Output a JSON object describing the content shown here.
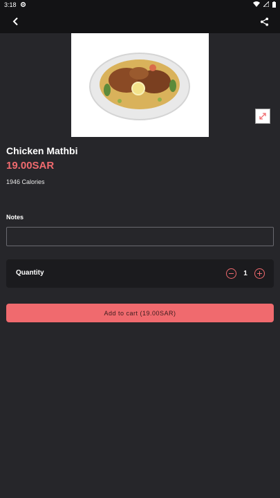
{
  "status": {
    "time": "3:18",
    "icons": [
      "settings-icon",
      "wifi-icon",
      "signal-icon",
      "battery-icon"
    ]
  },
  "toolbar": {
    "back_icon": "back-arrow-icon",
    "share_icon": "share-icon"
  },
  "product": {
    "name": "Chicken Mathbi",
    "price": "19.00SAR",
    "calories": "1946 Calories"
  },
  "notes": {
    "label": "Notes",
    "value": "",
    "placeholder": ""
  },
  "quantity": {
    "label": "Quantity",
    "value": "1"
  },
  "cart": {
    "button_label": "Add to cart (19.00SAR)"
  },
  "colors": {
    "accent": "#f06a6e",
    "background": "#26262a",
    "bar": "#131315",
    "card": "#1b1b1e"
  }
}
